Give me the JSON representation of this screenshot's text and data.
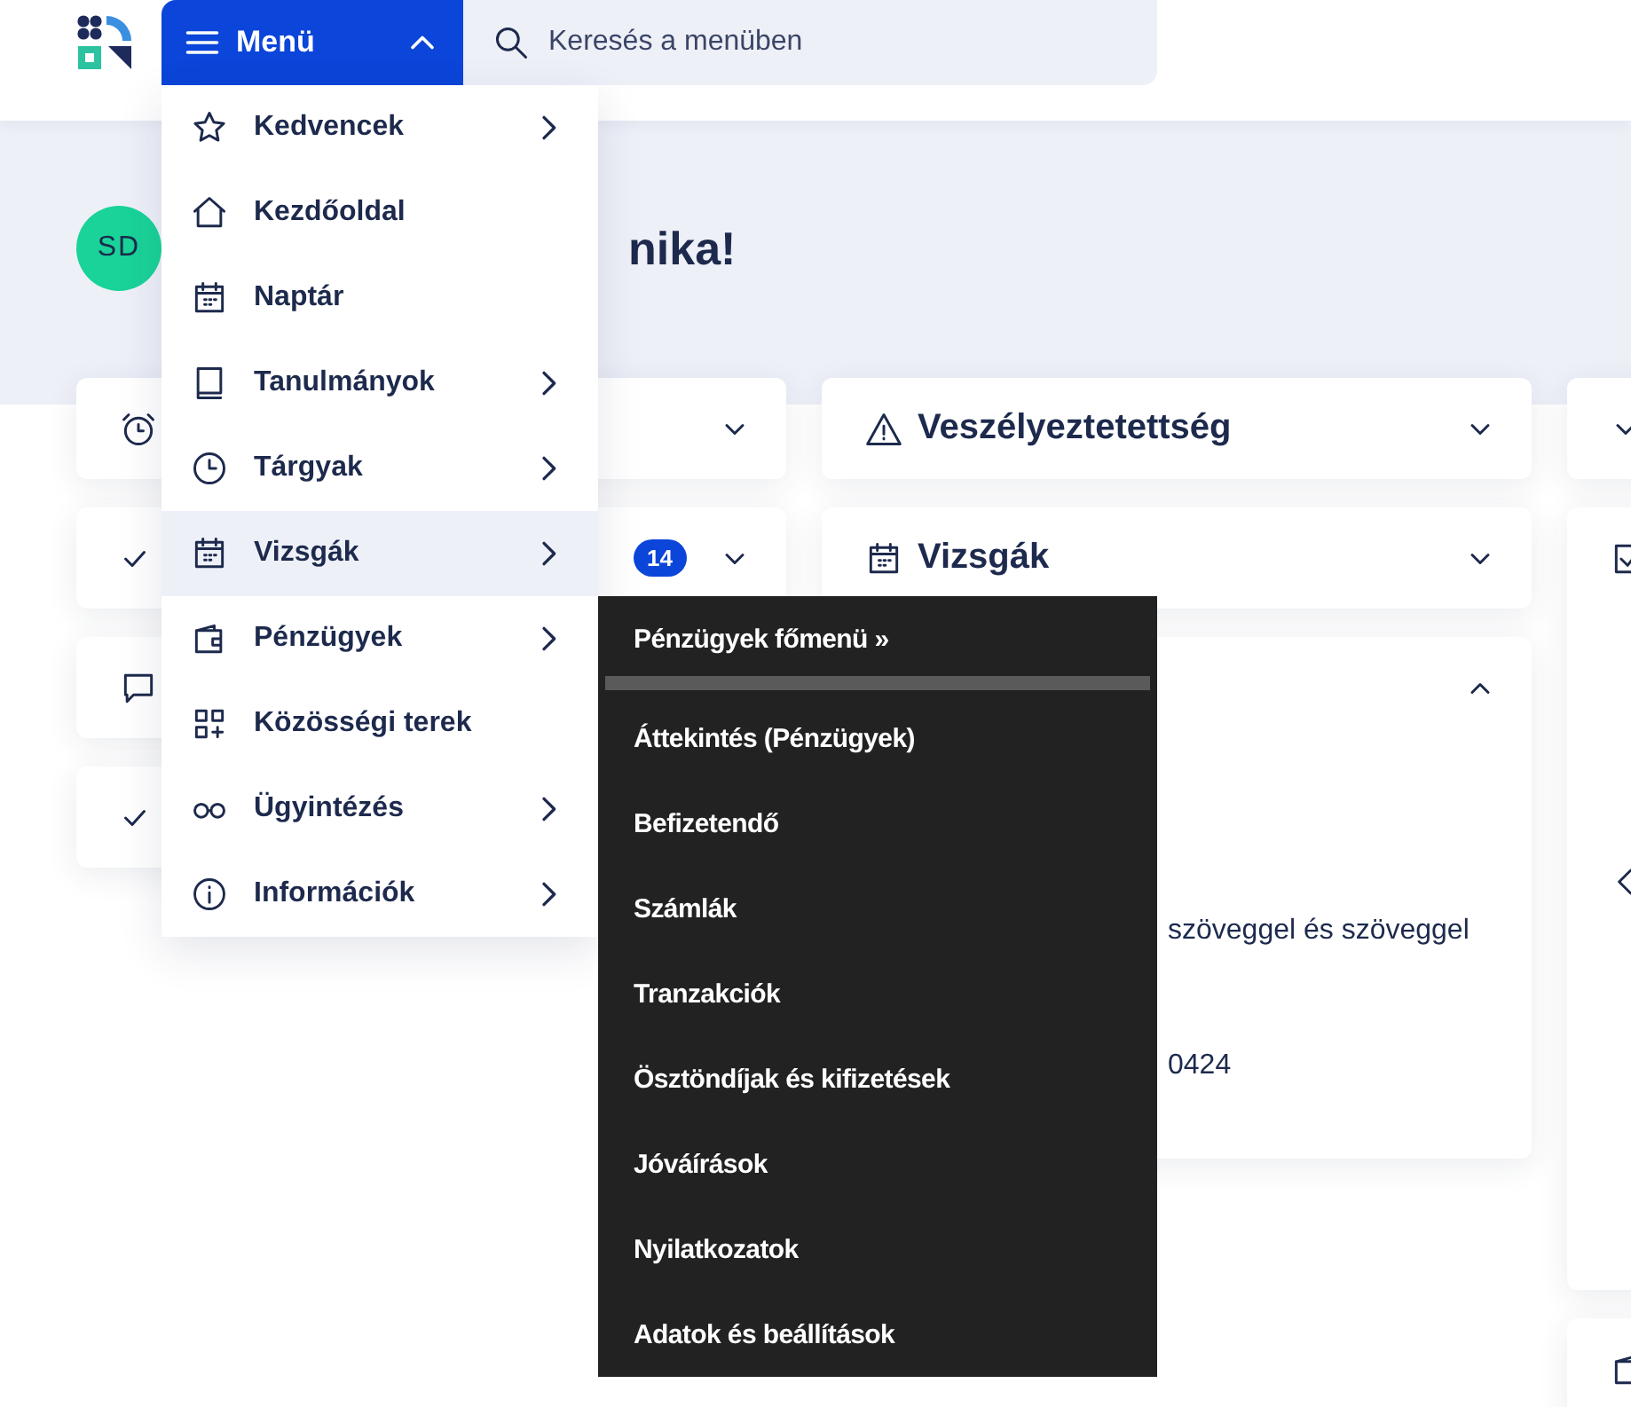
{
  "header": {
    "menu_button": {
      "label": "Menü",
      "expanded": true
    },
    "search": {
      "placeholder": "Keresés a menüben"
    }
  },
  "greeting": {
    "avatar_initials": "SD",
    "text": "nika!"
  },
  "columns": [
    {
      "cards": [
        {
          "kind": "header",
          "expanded": false
        },
        {
          "kind": "header",
          "badge": "14",
          "expanded": false
        },
        {
          "kind": "plain"
        },
        {
          "kind": "plain"
        }
      ]
    },
    {
      "cards": [
        {
          "title": "Veszélyeztetettség",
          "expanded": false
        },
        {
          "title": "Vizsgák",
          "expanded": false
        },
        {
          "expanded": true,
          "lines": [
            "szöveggel és szöveggel",
            "0424"
          ]
        }
      ]
    },
    {
      "cards": [
        {
          "kind": "toggle",
          "expanded": false
        },
        {
          "kind": "carousel"
        },
        {
          "kind": "plain"
        }
      ]
    }
  ],
  "menu": {
    "items": [
      {
        "label": "Kedvencek",
        "has_submenu": true,
        "selected": false
      },
      {
        "label": "Kezdőoldal",
        "has_submenu": false,
        "selected": false
      },
      {
        "label": "Naptár",
        "has_submenu": false,
        "selected": false
      },
      {
        "label": "Tanulmányok",
        "has_submenu": true,
        "selected": false
      },
      {
        "label": "Tárgyak",
        "has_submenu": true,
        "selected": false
      },
      {
        "label": "Vizsgák",
        "has_submenu": true,
        "selected": true
      },
      {
        "label": "Pénzügyek",
        "has_submenu": true,
        "selected": false
      },
      {
        "label": "Közösségi terek",
        "has_submenu": false,
        "selected": false
      },
      {
        "label": "Ügyintézés",
        "has_submenu": true,
        "selected": false
      },
      {
        "label": "Információk",
        "has_submenu": true,
        "selected": false
      }
    ]
  },
  "submenu": {
    "header": "Pénzügyek főmenü »",
    "items": [
      "Áttekintés (Pénzügyek)",
      "Befizetendő",
      "Számlák",
      "Tranzakciók",
      "Ösztöndíjak és kifizetések",
      "Jóváírások",
      "Nyilatkozatok",
      "Adatok és beállítások"
    ]
  }
}
